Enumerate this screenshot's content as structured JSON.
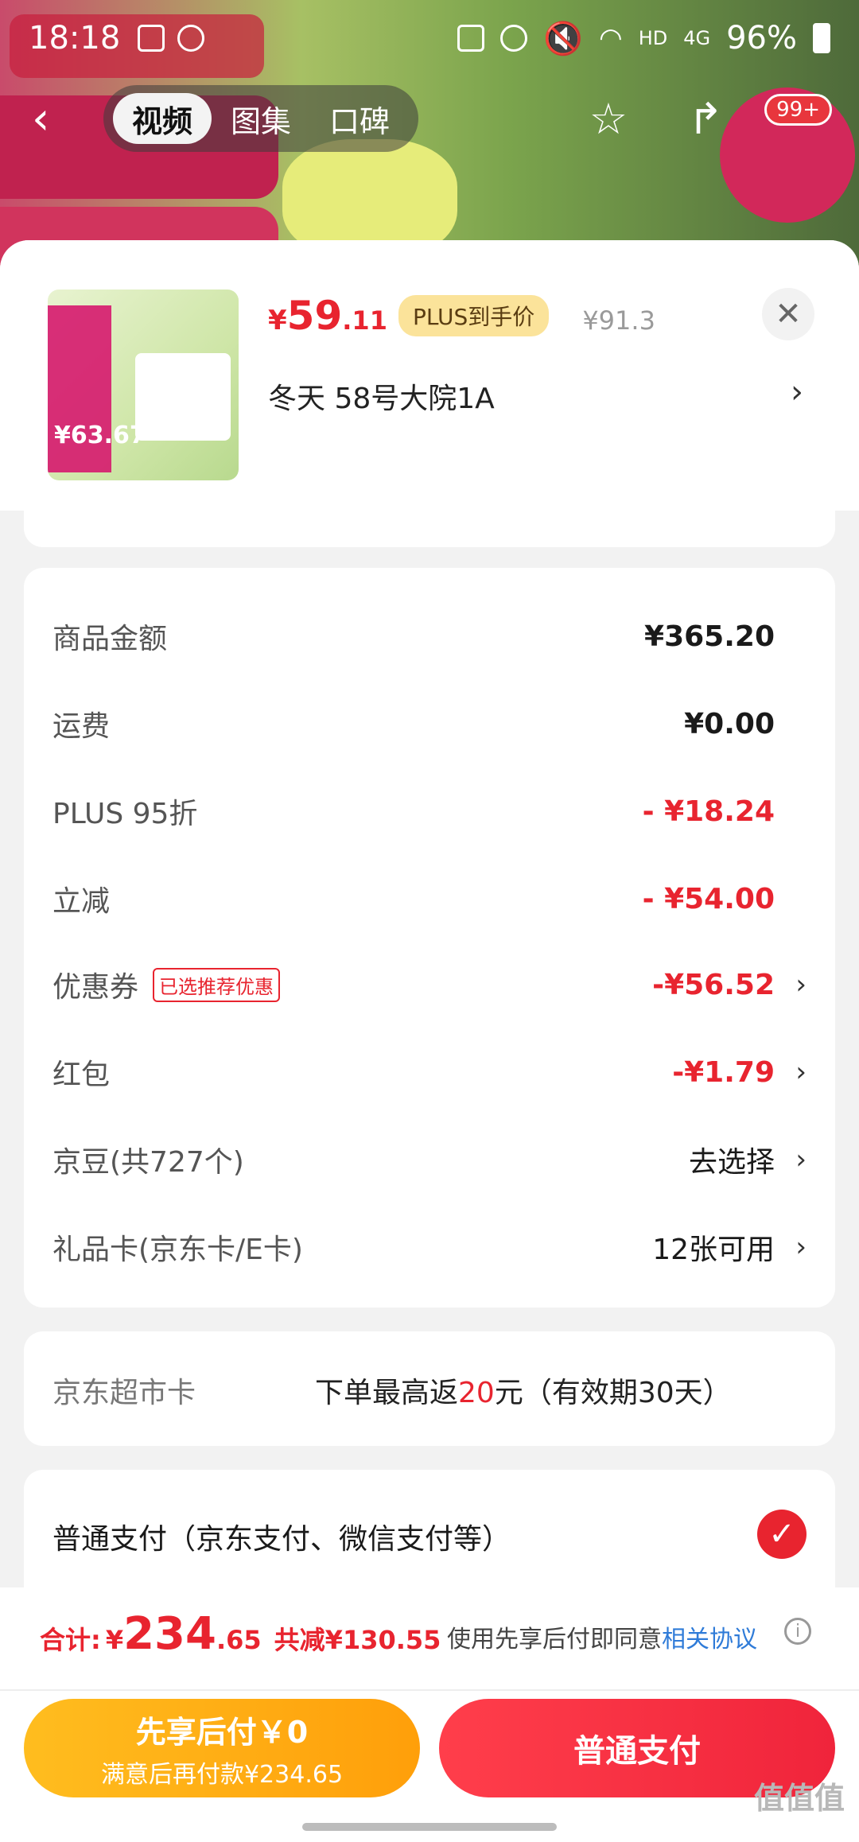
{
  "status_bar": {
    "time": "18:18",
    "network": "HD",
    "signal": "4G",
    "battery": "96%"
  },
  "nav": {
    "tabs": [
      {
        "label": "视频",
        "active": true
      },
      {
        "label": "图集",
        "active": false
      },
      {
        "label": "口碑",
        "active": false
      }
    ],
    "cart_count": "99+"
  },
  "product": {
    "price_symbol": "¥",
    "price_int": "59",
    "price_dec": ".11",
    "plus_label": "PLUS到手价",
    "original_price": "¥91.3",
    "address": "冬天  58号大院1A",
    "thumb_price": "¥63.67"
  },
  "fees": {
    "rows": [
      {
        "label": "商品金额",
        "value": "¥365.20",
        "style": "normal"
      },
      {
        "label": "运费",
        "value": "¥0.00",
        "style": "normal"
      },
      {
        "label": "PLUS 95折",
        "value": "- ¥18.24",
        "style": "red"
      },
      {
        "label": "立减",
        "value": "- ¥54.00",
        "style": "red"
      },
      {
        "label": "优惠券",
        "tag": "已选推荐优惠",
        "value": "-¥56.52",
        "style": "red"
      },
      {
        "label": "红包",
        "value": "-¥1.79",
        "style": "red"
      },
      {
        "label": "京豆(共727个)",
        "value": "去选择",
        "style": "plain"
      },
      {
        "label": "礼品卡(京东卡/E卡)",
        "value": "12张可用",
        "style": "plain"
      }
    ]
  },
  "supermarket_card": {
    "label": "京东超市卡",
    "text_before": "下单最高返",
    "amount": "20",
    "text_after": "元（有效期30天）"
  },
  "payment": {
    "method_label": "普通支付（京东支付、微信支付等）"
  },
  "footer": {
    "total_label": "合计:",
    "total_symbol": "¥",
    "total_int": "234",
    "total_dec": ".65",
    "saved": "共减¥130.55",
    "agreement_text": "使用先享后付即同意",
    "agreement_link": "相关协议",
    "bnpl_title": "先享后付￥0",
    "bnpl_sub": "满意后再付款¥234.65",
    "normal_pay": "普通支付"
  },
  "watermark": "值值值"
}
